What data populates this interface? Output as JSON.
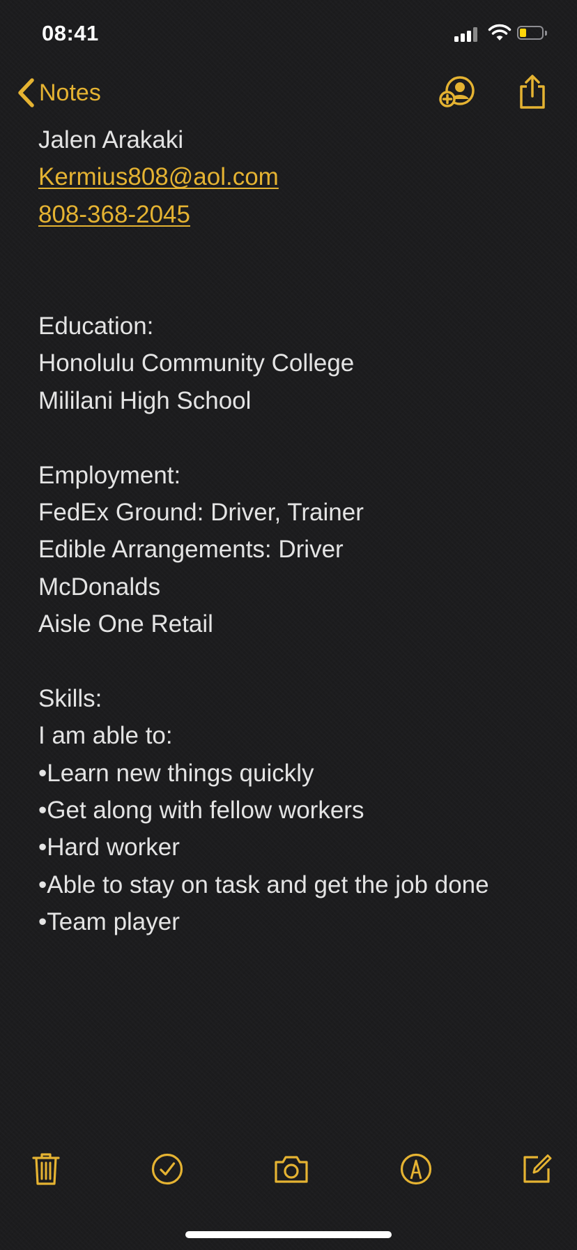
{
  "status_bar": {
    "time": "08:41",
    "battery_level": 0.3,
    "signal_bars": 3
  },
  "nav": {
    "back_label": "Notes",
    "back_icon": "chevron-left-icon",
    "add_person_icon": "add-person-icon",
    "share_icon": "share-icon"
  },
  "note": {
    "name": "Jalen Arakaki",
    "email": "Kermius808@aol.com",
    "phone": "808-368-2045",
    "education": {
      "heading": "Education:",
      "items": [
        "Honolulu Community College",
        "Mililani High School"
      ]
    },
    "employment": {
      "heading": "Employment:",
      "items": [
        "FedEx Ground: Driver, Trainer",
        "Edible Arrangements: Driver",
        "McDonalds",
        "Aisle One Retail"
      ]
    },
    "skills": {
      "heading": "Skills:",
      "intro": "I am able to:",
      "items": [
        "•Learn new things quickly",
        "•Get along with fellow workers",
        "•Hard worker",
        "•Able to stay on task and get the job done",
        "•Team player"
      ]
    }
  },
  "toolbar": {
    "icons": [
      "trash-icon",
      "checklist-icon",
      "camera-icon",
      "markup-icon",
      "compose-icon"
    ]
  },
  "colors": {
    "accent": "#e5b332",
    "background": "#1c1c1e",
    "text": "#e4e4e4"
  }
}
